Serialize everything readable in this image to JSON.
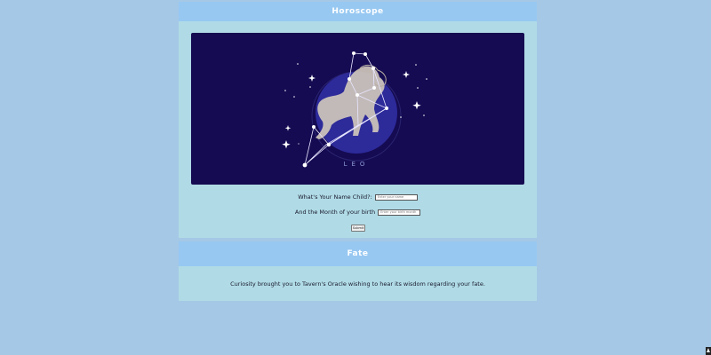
{
  "header": {
    "title": "Horoscope"
  },
  "hero": {
    "sign_label": "LEO",
    "image_name": "leo-constellation"
  },
  "form": {
    "name_label": "What's Your Name Child?:",
    "name_placeholder": "Enter your name",
    "month_label": "And the Month of your birth",
    "month_placeholder": "Enter your birth month",
    "submit_label": "Submit"
  },
  "fate": {
    "title": "Fate",
    "message": "Curiosity brought you to Tavern's Oracle wishing to hear its wisdom regarding your fate."
  },
  "colors": {
    "page_bg": "#a5c8e6",
    "header_bg": "#97c8f2",
    "card_bg": "#b0dbe6",
    "hero_bg": "#150b52",
    "hero_circle": "#2d2a9a"
  }
}
